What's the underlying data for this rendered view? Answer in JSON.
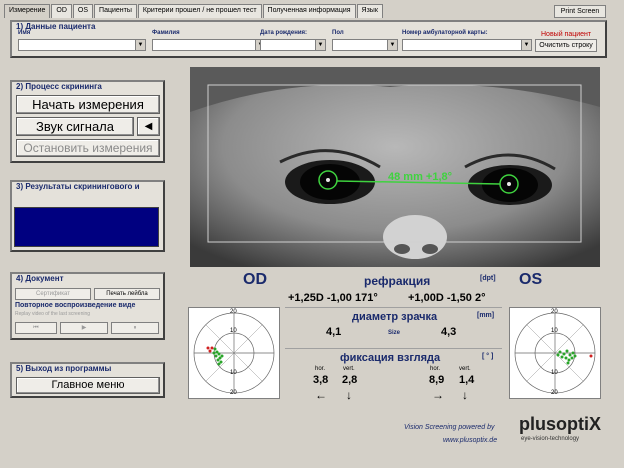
{
  "tabs": [
    "Измерение",
    "OD",
    "OS",
    "Пациенты",
    "Критерии прошел / не прошел тест",
    "Полученная информация",
    "Язык"
  ],
  "print_label": "Print Screen",
  "patient": {
    "title": "1) Данные пациента",
    "fields": [
      "Имя",
      "Фамилия",
      "Дата рождения:",
      "Пол",
      "Номер амбулаторной карты:"
    ],
    "new_patient": "Новый пациент",
    "clear_label": "Очистить строку"
  },
  "screening": {
    "title": "2) Процесс скрининга",
    "start_label": "Начать измерения",
    "sound_label": "Звук сигнала",
    "sound_icon": "speaker-icon",
    "stop_label": "Остановить измерения"
  },
  "results": {
    "title": "3) Результаты скринингового и"
  },
  "document": {
    "title": "4) Документ",
    "certificate_label": "Сертификат",
    "print_label_btn": "Печать лейбла",
    "replay_title": "Повторное воспроизведение виде",
    "replay_sub": "Replay video of the last screening"
  },
  "exit": {
    "title": "5) Выход из программы",
    "main_menu_label": "Главное меню"
  },
  "video": {
    "measurement": "48 mm  +1,8°"
  },
  "od_label": "OD",
  "os_label": "OS",
  "refraction": {
    "title": "рефракция",
    "unit": "[dpt]",
    "od": "+1,25D -1,00 171°",
    "os": "+1,00D -1,50 2°"
  },
  "pupil": {
    "title": "диаметр зрачка",
    "unit": "[mm]",
    "od": "4,1",
    "size_label": "Size",
    "os": "4,3"
  },
  "fixation": {
    "title": "фиксация взгляда",
    "unit": "[ ° ]",
    "hor_label": "hor.",
    "vert_label": "vert.",
    "od_hor": "3,8",
    "od_vert": "2,8",
    "os_hor": "8,9",
    "os_vert": "1,4",
    "od_hor_arrow": "←",
    "od_vert_arrow": "↓",
    "os_hor_arrow": "→",
    "os_vert_arrow": "↓"
  },
  "polar_ticks": [
    "20",
    "10",
    "10",
    "20"
  ],
  "footer": {
    "powered": "Vision Screening powered by",
    "url": "www.plusoptix.de",
    "brand": "plusoptiX",
    "tagline": "eye-vision-technology"
  }
}
